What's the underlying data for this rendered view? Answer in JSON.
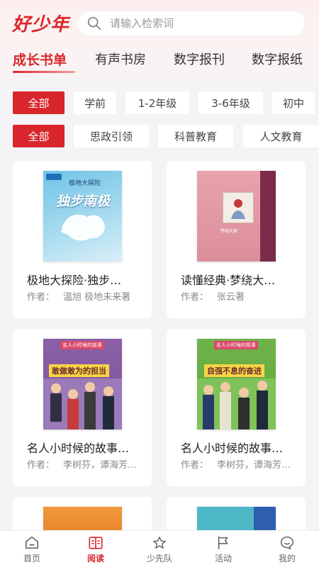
{
  "header": {
    "logo_text": "好少年",
    "search_placeholder": "请输入检索词"
  },
  "tabs": [
    {
      "label": "成长书单",
      "active": true
    },
    {
      "label": "有声书房",
      "active": false
    },
    {
      "label": "数字报刊",
      "active": false
    },
    {
      "label": "数字报纸",
      "active": false
    }
  ],
  "grade_filters": [
    {
      "label": "全部",
      "active": true
    },
    {
      "label": "学前",
      "active": false
    },
    {
      "label": "1-2年级",
      "active": false
    },
    {
      "label": "3-6年级",
      "active": false
    },
    {
      "label": "初中",
      "active": false
    }
  ],
  "topic_filters": [
    {
      "label": "全部",
      "active": true
    },
    {
      "label": "思政引领",
      "active": false
    },
    {
      "label": "科普教育",
      "active": false
    },
    {
      "label": "人文教育",
      "active": false
    }
  ],
  "books": [
    {
      "title": "极地大探险·独步…",
      "author_label": "作者：",
      "author": "温旭  极地未来著",
      "cover_text": "独步南极",
      "cover_series": "极地大探险"
    },
    {
      "title": "读懂经典·梦绕大…",
      "author_label": "作者：",
      "author": "张云著",
      "cover_text": "梦绕大观"
    },
    {
      "title": "名人小时候的故事…",
      "author_label": "作者：",
      "author": "李树芬，谭海芳…",
      "cover_text": "敢做敢为的担当",
      "cover_series": "名人小时候的故事"
    },
    {
      "title": "名人小时候的故事…",
      "author_label": "作者：",
      "author": "李树芬，谭海芳…",
      "cover_text": "自强不息的奋进",
      "cover_series": "名人小时候的故事"
    }
  ],
  "bottom_nav": [
    {
      "label": "首页",
      "icon": "home-icon",
      "active": false
    },
    {
      "label": "阅读",
      "icon": "book-icon",
      "active": true
    },
    {
      "label": "少先队",
      "icon": "star-icon",
      "active": false
    },
    {
      "label": "活动",
      "icon": "flag-icon",
      "active": false
    },
    {
      "label": "我的",
      "icon": "chat-face-icon",
      "active": false
    }
  ],
  "colors": {
    "accent": "#d9262c",
    "background": "#f4f4f6"
  }
}
